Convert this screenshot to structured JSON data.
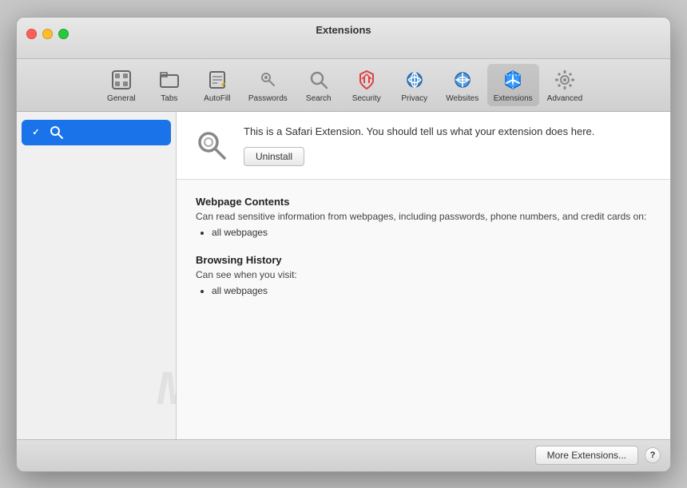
{
  "window": {
    "title": "Extensions",
    "controls": {
      "close_label": "close",
      "minimize_label": "minimize",
      "maximize_label": "maximize"
    }
  },
  "toolbar": {
    "items": [
      {
        "id": "general",
        "label": "General",
        "icon": "general"
      },
      {
        "id": "tabs",
        "label": "Tabs",
        "icon": "tabs"
      },
      {
        "id": "autofill",
        "label": "AutoFill",
        "icon": "autofill"
      },
      {
        "id": "passwords",
        "label": "Passwords",
        "icon": "passwords"
      },
      {
        "id": "search",
        "label": "Search",
        "icon": "search"
      },
      {
        "id": "security",
        "label": "Security",
        "icon": "security"
      },
      {
        "id": "privacy",
        "label": "Privacy",
        "icon": "privacy"
      },
      {
        "id": "websites",
        "label": "Websites",
        "icon": "websites"
      },
      {
        "id": "extensions",
        "label": "Extensions",
        "icon": "extensions",
        "active": true
      },
      {
        "id": "advanced",
        "label": "Advanced",
        "icon": "advanced"
      }
    ]
  },
  "sidebar": {
    "items": [
      {
        "id": "search-extension",
        "label": "Search",
        "checked": true,
        "selected": true
      }
    ]
  },
  "extension": {
    "description": "This is a Safari Extension. You should tell us what your extension does here.",
    "uninstall_label": "Uninstall"
  },
  "permissions": {
    "sections": [
      {
        "id": "webpage-contents",
        "title": "Webpage Contents",
        "description": "Can read sensitive information from webpages, including passwords, phone numbers, and credit cards on:",
        "items": [
          "all webpages"
        ]
      },
      {
        "id": "browsing-history",
        "title": "Browsing History",
        "description": "Can see when you visit:",
        "items": [
          "all webpages"
        ]
      }
    ]
  },
  "footer": {
    "more_extensions_label": "More Extensions...",
    "help_label": "?"
  },
  "watermark": {
    "text": "MALWARETIPS"
  }
}
